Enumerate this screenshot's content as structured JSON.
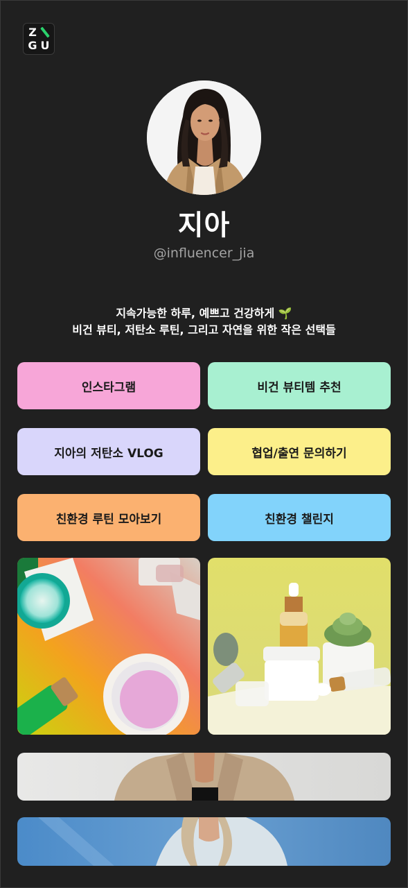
{
  "brand": {
    "logo_letters": [
      "Z",
      "G",
      "U"
    ],
    "accent": "#2bd16c"
  },
  "profile": {
    "name": "지아",
    "handle": "@influencer_jia",
    "bio_line1": "지속가능한 하루, 예쁘고 건강하게 🌱",
    "bio_line2": "비건 뷰티, 저탄소 루틴, 그리고 자연을 위한 작은 선택들"
  },
  "links": [
    {
      "label": "인스타그램",
      "color": "#f7a6d8"
    },
    {
      "label": "비건 뷰티템 추천",
      "color": "#a8f0d1"
    },
    {
      "label": "지아의 저탄소 VLOG",
      "color": "#d9d6fb"
    },
    {
      "label": "협업/출연 문의하기",
      "color": "#fcef8a"
    },
    {
      "label": "친환경 루틴 모아보기",
      "color": "#fbb170"
    },
    {
      "label": "친환경 챌린지",
      "color": "#82d3fb"
    }
  ],
  "colors": {
    "background": "#202020",
    "text_primary": "#ffffff",
    "text_secondary": "#a3a3a3"
  }
}
